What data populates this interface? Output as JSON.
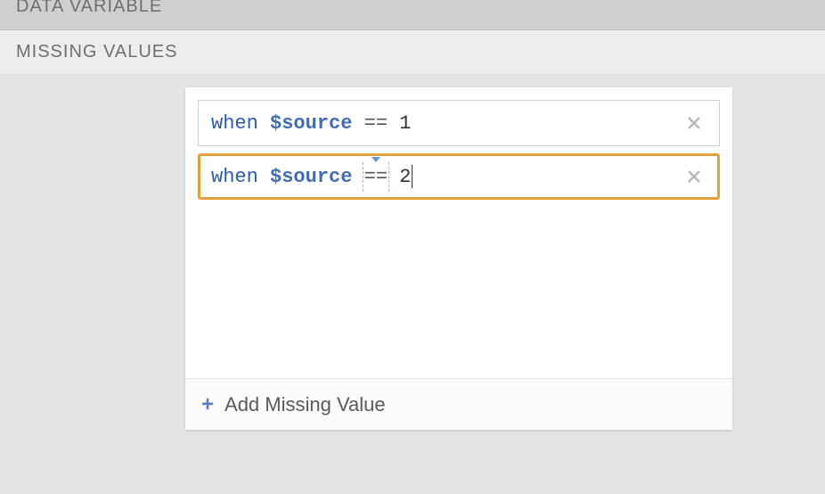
{
  "top_section_label": "DATA VARIABLE",
  "section_label": "MISSING VALUES",
  "rules": [
    {
      "keyword": "when",
      "variable": "$source",
      "operator": "==",
      "value": "1",
      "active": false
    },
    {
      "keyword": "when",
      "variable": "$source",
      "operator": "==",
      "value": "2",
      "active": true
    }
  ],
  "add_button_label": "Add Missing Value",
  "icons": {
    "close": "close-icon",
    "plus": "plus-icon",
    "dropdown_caret": "chevron-down-icon"
  }
}
